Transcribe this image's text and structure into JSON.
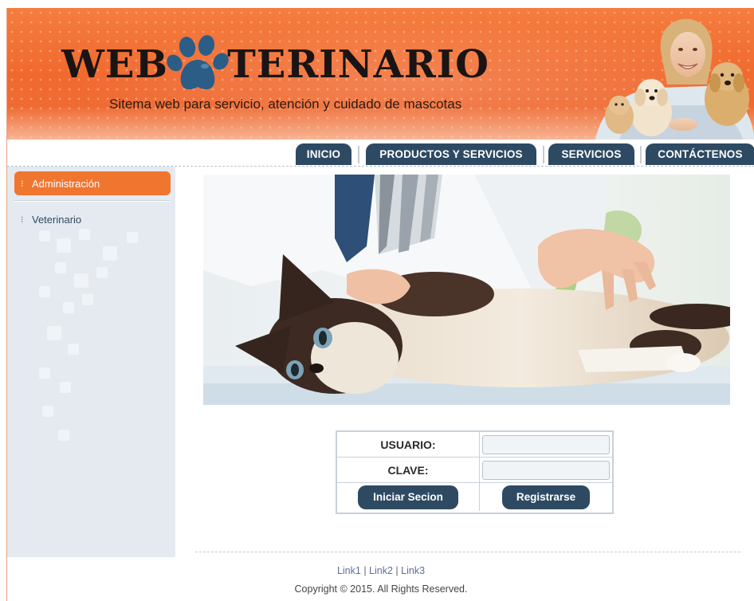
{
  "header": {
    "logo_left": "WEB",
    "logo_right": "TERINARIO",
    "tagline": "Sitema web para servicio, atención y cuidado de mascotas"
  },
  "nav": {
    "items": [
      {
        "label": "INICIO"
      },
      {
        "label": "PRODUCTOS Y SERVICIOS"
      },
      {
        "label": "SERVICIOS"
      },
      {
        "label": "CONTÁCTENOS"
      }
    ]
  },
  "sidebar": {
    "items": [
      {
        "label": "Administración",
        "active": true
      },
      {
        "label": "Veterinario",
        "active": false
      }
    ]
  },
  "login": {
    "user_label": "USUARIO:",
    "user_value": "",
    "password_label": "CLAVE:",
    "password_value": "",
    "login_button": "Iniciar Secion",
    "register_button": "Registrarse"
  },
  "footer": {
    "link1": "Link1",
    "link2": "Link2",
    "link3": "Link3",
    "separator": "|",
    "copyright": "Copyright © 2015. All Rights Reserved."
  },
  "colors": {
    "accent_orange": "#f0762f",
    "nav_blue": "#2e4a63",
    "sidebar_bg": "#e4eaf0"
  },
  "icons": {
    "logo_icon": "paw-icon",
    "bullet_icon": "bullet-dots-icon"
  }
}
